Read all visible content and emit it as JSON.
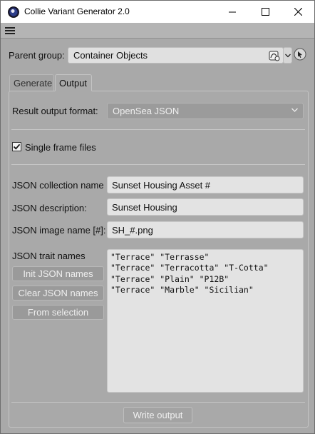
{
  "window": {
    "title": "Collie Variant Generator 2.0",
    "icon": "cinema4d-icon"
  },
  "menubar": {
    "icon": "hamburger-menu-icon"
  },
  "parent_group": {
    "label": "Parent group:",
    "value": "Container Objects",
    "icons": [
      "object-link-icon",
      "dropdown-arrow-icon",
      "pick-cursor-icon"
    ]
  },
  "tabs": [
    {
      "label": "Generate",
      "active": false
    },
    {
      "label": "Output",
      "active": true
    }
  ],
  "output": {
    "format_label": "Result output format:",
    "format_value": "OpenSea JSON",
    "single_frame": {
      "label": "Single frame files",
      "checked": true
    },
    "collection_name": {
      "label": "JSON collection name",
      "value": "Sunset Housing Asset #"
    },
    "description": {
      "label": "JSON description:",
      "value": "Sunset Housing"
    },
    "image_name": {
      "label": "JSON image name [#]:",
      "value": "SH_#.png"
    },
    "trait_names": {
      "label": "JSON trait names",
      "lines": [
        "\"Terrace\" \"Terrasse\"",
        "\"Terrace\" \"Terracotta\" \"T-Cotta\"",
        "\"Terrace\" \"Plain\" \"P12B\"",
        "\"Terrace\" \"Marble\" \"Sicilian\""
      ]
    },
    "buttons": {
      "init": "Init JSON names",
      "clear": "Clear JSON names",
      "from_selection": "From selection"
    },
    "write_output": "Write output"
  },
  "colors": {
    "background": "#a9a9a9",
    "field": "#e3e3e3",
    "button": "#9a9a9a",
    "button_text": "#eeeeee"
  }
}
